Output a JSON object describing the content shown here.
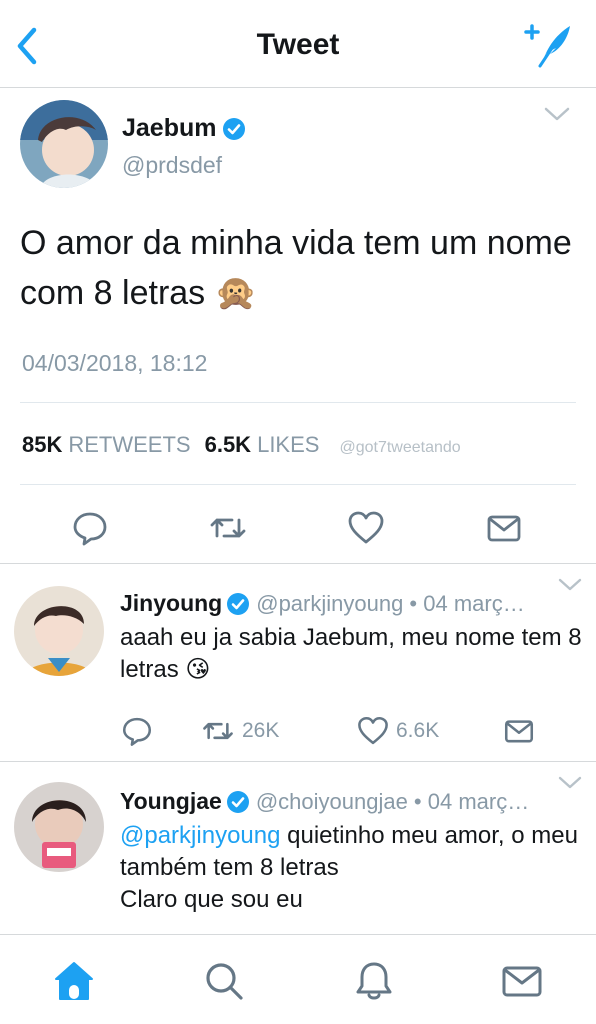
{
  "nav": {
    "title": "Tweet",
    "back_icon": "chevron-left-icon",
    "compose_icon": "compose-feather-icon"
  },
  "colors": {
    "accent": "#1da1f2",
    "muted": "#8899a6",
    "text": "#14171a",
    "divider": "#e1e8ed"
  },
  "tweet": {
    "name": "Jaebum",
    "handle": "@prdsdef",
    "text": "O amor da minha vida tem um nome com 8 letras 🙊",
    "date": "04/03/2018, 18:12",
    "retweets_count": "85K",
    "retweets_label": "RETWEETS",
    "likes_count": "6.5K",
    "likes_label": "LIKES",
    "watermark": "@got7tweetando"
  },
  "replies": [
    {
      "name": "Jinyoung",
      "handle": "@parkjinyoung • 04 març…",
      "mention": "",
      "text": "aaah eu ja sabia Jaebum, meu nome tem 8 letras 😘",
      "retweets": "26K",
      "likes": "6.6K"
    },
    {
      "name": "Youngjae",
      "handle": "@choiyoungjae • 04 març…",
      "mention": "@parkjinyoung",
      "text": " quietinho meu amor, o meu também tem 8 letras",
      "text2": "Claro que sou eu"
    }
  ],
  "tabs": [
    "home-icon",
    "search-icon",
    "notifications-bell-icon",
    "messages-envelope-icon"
  ]
}
